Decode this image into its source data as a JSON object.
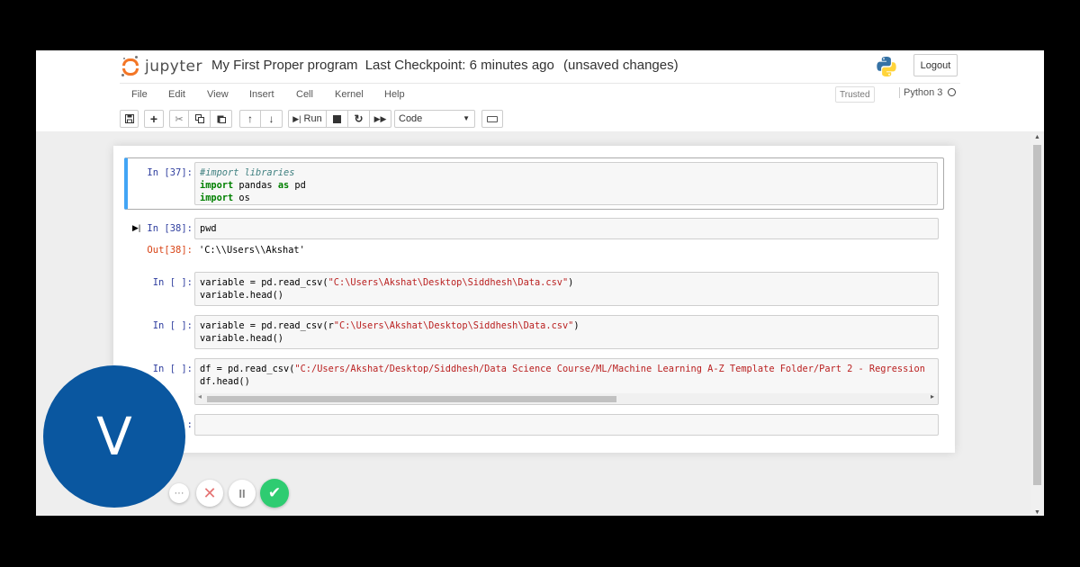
{
  "header": {
    "logo_text": "jupyter",
    "notebook_name": "My First Proper program",
    "checkpoint": "Last Checkpoint: 6 minutes ago",
    "unsaved": "(unsaved changes)",
    "logout_label": "Logout"
  },
  "menu": {
    "items": [
      "File",
      "Edit",
      "View",
      "Insert",
      "Cell",
      "Kernel",
      "Help"
    ],
    "trusted": "Trusted",
    "kernel": "Python 3"
  },
  "toolbar": {
    "run_label": "Run",
    "cell_type": "Code"
  },
  "cells": {
    "c1": {
      "prompt": "In [37]:",
      "lines": [
        "#import libraries",
        "import pandas as pd",
        "import os"
      ]
    },
    "c2": {
      "prompt": "In [38]:",
      "code": "pwd",
      "out_prompt": "Out[38]:",
      "output": "'C:\\\\Users\\\\Akshat'"
    },
    "c3": {
      "prompt": "In [ ]:",
      "line1_pre": "variable = pd.read_csv(",
      "line1_str": "\"C:\\Users\\Akshat\\Desktop\\Siddhesh\\Data.csv\"",
      "line1_post": ")",
      "line2": "variable.head()"
    },
    "c4": {
      "prompt": "In [ ]:",
      "line1_pre": "variable = pd.read_csv(r",
      "line1_str": "\"C:\\Users\\Akshat\\Desktop\\Siddhesh\\Data.csv\"",
      "line1_post": ")",
      "line2": "variable.head()"
    },
    "c5": {
      "prompt": "In [ ]:",
      "line1_pre": "df = pd.read_csv(",
      "line1_str": "\"C:/Users/Akshat/Desktop/Siddhesh/Data Science Course/ML/Machine Learning A-Z Template Folder/Part 2 - Regression",
      "line2": "df.head()"
    },
    "c6": {
      "prompt_tail": ":"
    }
  },
  "overlay": {
    "avatar_letter": "V",
    "more": "···",
    "cancel": "✕",
    "pause": "II",
    "confirm": "✔"
  },
  "colors": {
    "jupyter_orange": "#f37626",
    "selected_cell_bar": "#42a5f5",
    "in_prompt": "#303f9f",
    "out_prompt": "#d84315",
    "avatar_blue": "#0a57a0",
    "confirm_green": "#2ecc71"
  },
  "icons": [
    "save-icon",
    "plus-icon",
    "cut-icon",
    "copy-icon",
    "paste-icon",
    "arrow-up-icon",
    "arrow-down-icon",
    "step-icon",
    "stop-icon",
    "restart-icon",
    "fast-forward-icon",
    "keyboard-icon",
    "python-logo-icon"
  ]
}
